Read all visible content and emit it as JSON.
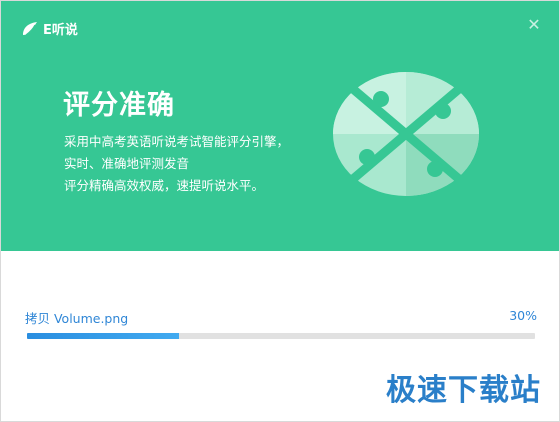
{
  "app": {
    "logo_text": "E听说"
  },
  "banner": {
    "title": "评分准确",
    "description_lines": [
      "采用中高考英语听说考试智能评分引擎，",
      "实时、准确地评测发音",
      "评分精确高效权威，速提听说水平。"
    ],
    "illustration": "puzzle-icon"
  },
  "progress": {
    "file_label": "拷贝 Volume.png",
    "percent_label": "30%",
    "value": 0.3
  },
  "watermark": {
    "text": "极速下载站"
  },
  "colors": {
    "banner": "#36c794",
    "progress_fill": "#2a8ee0",
    "progress_track": "#e1e1e1",
    "label_text": "#2f86d6"
  },
  "icons": {
    "close": "close-icon",
    "logo": "leaf-logo-icon"
  }
}
